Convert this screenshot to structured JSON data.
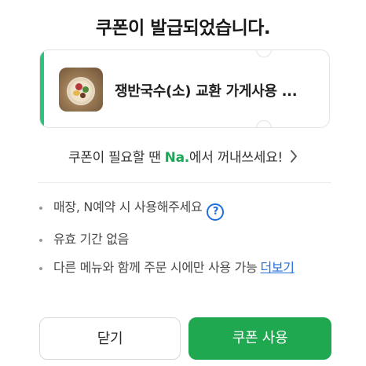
{
  "dialog": {
    "title": "쿠폰이 발급되었습니다.",
    "coupon": {
      "name": "쟁반국수(소) 교환 가게사용 ...",
      "accent_color": "#2ec27e"
    },
    "tip": {
      "prefix": "쿠폰이 필요할 땐 ",
      "brand": "Na.",
      "suffix": "에서 꺼내쓰세요!",
      "chevron": "chevron-right-icon"
    },
    "notes": [
      {
        "text": "매장, N예약 시 사용해주세요",
        "help_icon": "?"
      },
      {
        "text": "유효 기간 없음"
      },
      {
        "text": "다른 메뉴와 함께 주문 시에만 사용 가능",
        "link": "더보기"
      }
    ],
    "buttons": {
      "close": "닫기",
      "use": "쿠폰 사용"
    },
    "colors": {
      "primary": "#1fa850",
      "link": "#1f6fe0",
      "brand_text": "#18a957"
    }
  }
}
